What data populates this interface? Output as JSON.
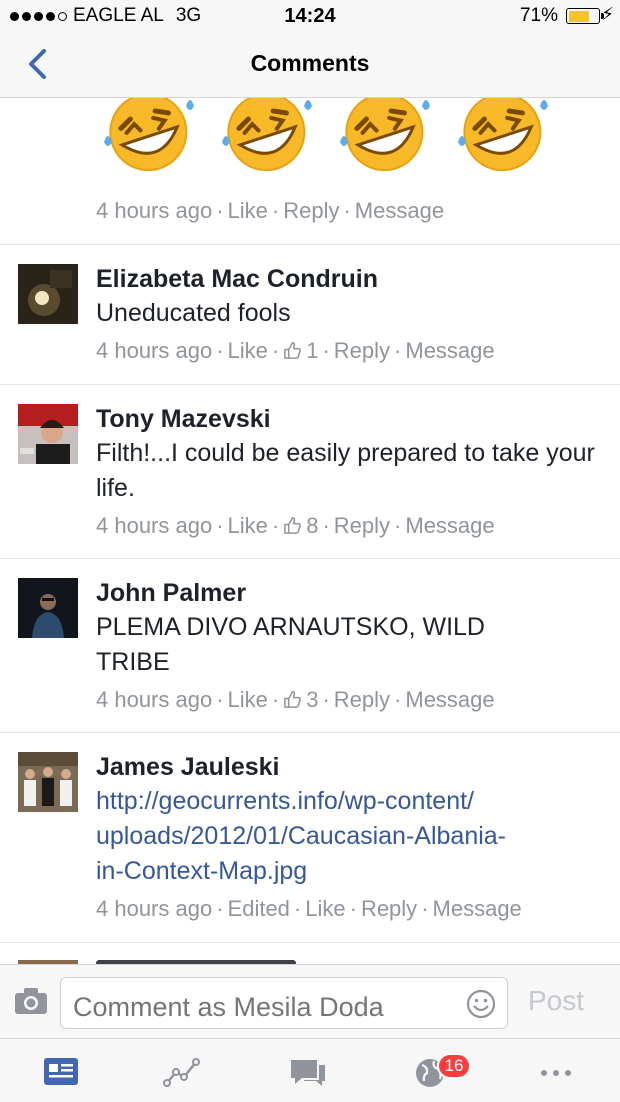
{
  "status_bar": {
    "carrier": "EAGLE AL",
    "network": "3G",
    "time": "14:24",
    "battery_percent": "71%",
    "battery_level": 0.71
  },
  "nav": {
    "title": "Comments"
  },
  "top_comment_meta": {
    "time": "4 hours ago",
    "like": "Like",
    "reply": "Reply",
    "message": "Message"
  },
  "comments": [
    {
      "name": "Elizabeta Mac Condruin",
      "text": "Uneducated fools",
      "time": "4 hours ago",
      "like": "Like",
      "likes_count": "1",
      "reply": "Reply",
      "message": "Message"
    },
    {
      "name": "Tony Mazevski",
      "text": "Filth!...I could be easily prepared to take your life.",
      "time": "4 hours ago",
      "like": "Like",
      "likes_count": "8",
      "reply": "Reply",
      "message": "Message"
    },
    {
      "name": "John Palmer",
      "text": "PLEMA DIVO ARNAUTSKO, WILD TRIBE",
      "time": "4 hours ago",
      "like": "Like",
      "likes_count": "3",
      "reply": "Reply",
      "message": "Message"
    },
    {
      "name": "James Jauleski",
      "text_lines": [
        "http://geocurrents.info/wp-content/",
        "uploads/2012/01/Caucasian-Albania-",
        "in-Context-Map.jpg"
      ],
      "time": "4 hours ago",
      "edited": "Edited",
      "like": "Like",
      "reply": "Reply",
      "message": "Message"
    }
  ],
  "composer": {
    "placeholder": "Comment as Mesila Doda",
    "post_label": "Post"
  },
  "tab_bar": {
    "notifications_badge": "16"
  },
  "icons": {
    "back": "chevron-left-icon",
    "emoji": "rolling-on-floor-laughing-icon",
    "thumb": "thumbs-up-icon",
    "camera": "camera-icon",
    "smile": "smiley-icon",
    "news_feed": "news-feed-icon",
    "activity": "activity-icon",
    "messages": "messages-icon",
    "notifications": "globe-icon",
    "more": "more-icon"
  },
  "colors": {
    "link": "#365899",
    "accent": "#4267b2",
    "meta": "#90949c",
    "badge": "#fa3e3e"
  }
}
